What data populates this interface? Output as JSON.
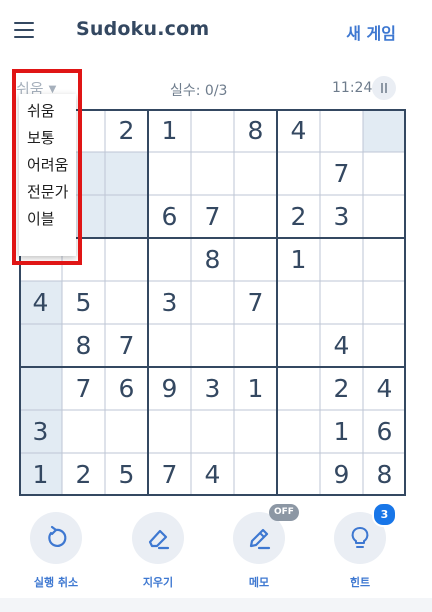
{
  "header": {
    "logo_text": "Sudoku.com",
    "new_game_label": "새 게임"
  },
  "status": {
    "difficulty": "쉬움",
    "mistakes": "실수: 0/3",
    "timer": "11:24"
  },
  "difficulty_menu": {
    "options": [
      "쉬움",
      "보통",
      "어려움",
      "전문가",
      "이블"
    ]
  },
  "board": {
    "rows": [
      [
        "",
        "",
        "2",
        "1",
        "",
        "8",
        "4",
        "",
        ""
      ],
      [
        "",
        "",
        "",
        "",
        "",
        "",
        "",
        "7",
        ""
      ],
      [
        "",
        "",
        "",
        "6",
        "7",
        "",
        "2",
        "3",
        ""
      ],
      [
        "",
        "",
        "",
        "",
        "8",
        "",
        "1",
        "",
        ""
      ],
      [
        "4",
        "5",
        "",
        "3",
        "",
        "7",
        "",
        "",
        ""
      ],
      [
        "",
        "8",
        "7",
        "",
        "",
        "",
        "",
        "4",
        ""
      ],
      [
        "",
        "7",
        "6",
        "9",
        "3",
        "1",
        "",
        "2",
        "4"
      ],
      [
        "3",
        "",
        "",
        "",
        "",
        "",
        "",
        "1",
        "6"
      ],
      [
        "1",
        "2",
        "5",
        "7",
        "4",
        "",
        "",
        "9",
        "8"
      ]
    ]
  },
  "toolbar": {
    "undo_label": "실행 취소",
    "erase_label": "지우기",
    "notes_label": "메모",
    "notes_state": "OFF",
    "hint_label": "힌트",
    "hint_count": "3"
  },
  "colors": {
    "text_primary": "#344861",
    "accent_blue": "#3e78d1",
    "highlight_cell": "#e2ebf3",
    "grid_line_bold": "#344861",
    "grid_line_thin": "#bec6d4",
    "highlight_border_red": "#e01515"
  }
}
